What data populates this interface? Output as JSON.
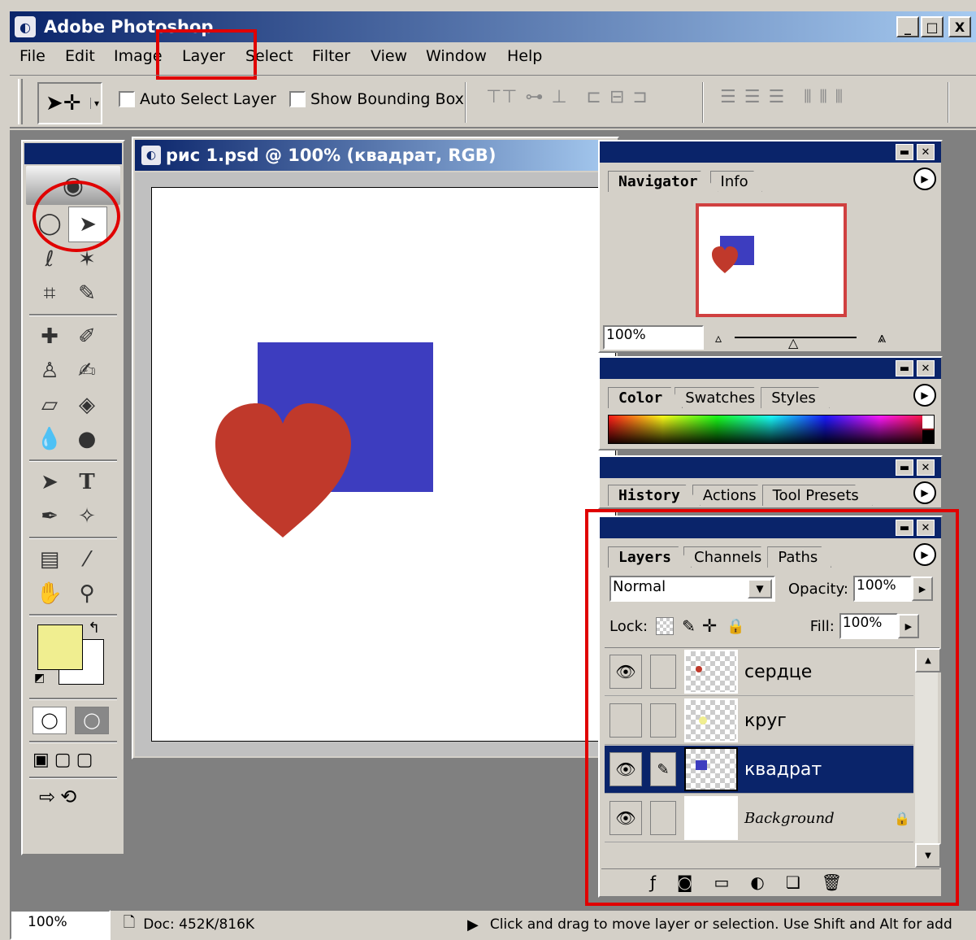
{
  "window": {
    "title": "Adobe Photoshop",
    "min_label": "_",
    "max_label": "□",
    "close_label": "X"
  },
  "menu": [
    "File",
    "Edit",
    "Image",
    "Layer",
    "Select",
    "Filter",
    "View",
    "Window",
    "Help"
  ],
  "options_bar": {
    "tool_icon": "move-tool-icon",
    "auto_select_label": "Auto Select Layer",
    "bounding_box_label": "Show Bounding Box"
  },
  "document": {
    "title": "рис 1.psd @ 100% (квадрат, RGB)"
  },
  "canvas_colors": {
    "square": "#3d3dbf",
    "heart": "#c0392b",
    "background": "#ffffff"
  },
  "navigator": {
    "tabs": [
      "Navigator",
      "Info"
    ],
    "zoom": "100%"
  },
  "color_panel": {
    "tabs": [
      "Color",
      "Swatches",
      "Styles"
    ]
  },
  "history_panel": {
    "tabs": [
      "History",
      "Actions",
      "Tool Presets"
    ]
  },
  "layers_panel": {
    "tabs": [
      "Layers",
      "Channels",
      "Paths"
    ],
    "blend_mode": "Normal",
    "opacity_label": "Opacity:",
    "opacity": "100%",
    "lock_label": "Lock:",
    "fill_label": "Fill:",
    "fill": "100%",
    "layers": [
      {
        "name": "сердце",
        "visible": true,
        "selected": false,
        "thumb_color": "#c0392b"
      },
      {
        "name": "круг",
        "visible": false,
        "selected": false,
        "thumb_color": "#f0ee90"
      },
      {
        "name": "квадрат",
        "visible": true,
        "selected": true,
        "thumb_color": "#3d3dbf"
      },
      {
        "name": "Background",
        "visible": true,
        "selected": false,
        "thumb_color": "#ffffff"
      }
    ]
  },
  "swatches": {
    "foreground": "#f0ee90",
    "background": "#ffffff"
  },
  "status_bar": {
    "zoom": "100%",
    "doc": "Doc: 452K/816K",
    "hint": "Click and drag to move layer or selection.  Use Shift and Alt for add"
  },
  "annotations": {
    "color": "#e00000"
  }
}
